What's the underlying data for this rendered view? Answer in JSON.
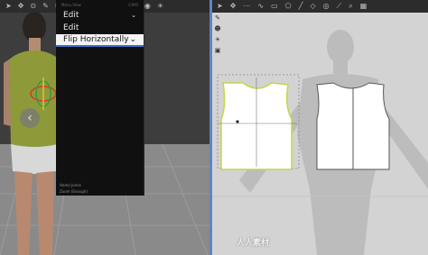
{
  "panel": {
    "header_left": "Menu View",
    "header_right": "CAYO",
    "row1_label": "Edit",
    "row2_label": "Edit",
    "selected_label": "Flip Horizontally",
    "footer1": "Hemo Jones",
    "footer2": "Zoom (Enough)"
  },
  "toolbar3d_icons": [
    "pointer-icon",
    "transform-icon",
    "pin-icon",
    "tool-icon",
    "cut-icon",
    "sew-icon",
    "arrow-icon",
    "fold-icon",
    "layer-icon",
    "grid-icon",
    "avatar-icon",
    "camera-icon",
    "light-icon"
  ],
  "toolbar2d_icons": [
    "select-icon",
    "transform-icon",
    "points-icon",
    "curve-icon",
    "rect-icon",
    "polygon-icon",
    "internal-line-icon",
    "dart-icon",
    "trace-icon",
    "sew-icon",
    "zoom-icon",
    "grid-icon"
  ],
  "watermark": "人人素材"
}
